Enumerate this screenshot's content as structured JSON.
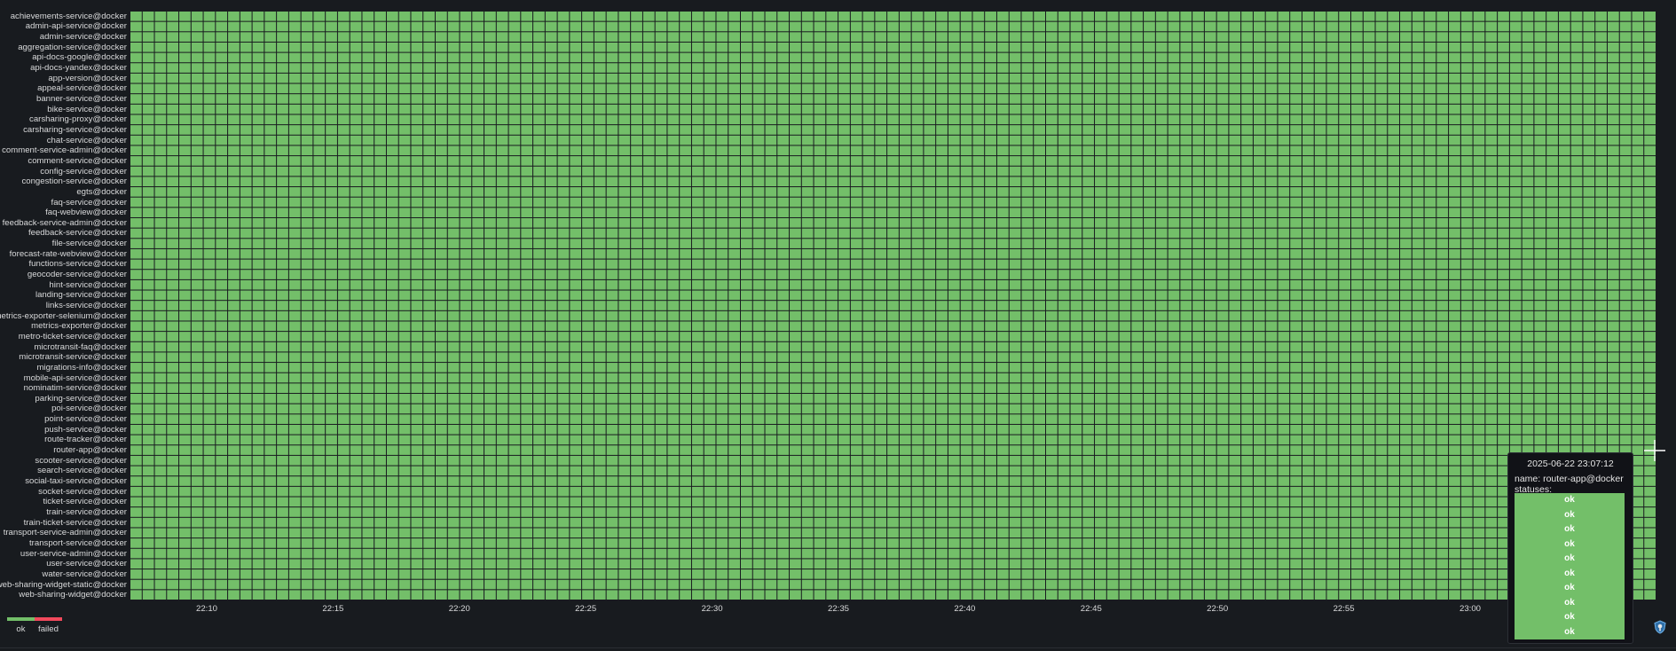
{
  "colors": {
    "ok": "#73bf69",
    "failed": "#f2495c",
    "background": "#181b1f",
    "cell_border": "#181b1f",
    "text": "#d8d9da"
  },
  "services": [
    "achievements-service@docker",
    "admin-api-service@docker",
    "admin-service@docker",
    "aggregation-service@docker",
    "api-docs-google@docker",
    "api-docs-yandex@docker",
    "app-version@docker",
    "appeal-service@docker",
    "banner-service@docker",
    "bike-service@docker",
    "carsharing-proxy@docker",
    "carsharing-service@docker",
    "chat-service@docker",
    "comment-service-admin@docker",
    "comment-service@docker",
    "config-service@docker",
    "congestion-service@docker",
    "egts@docker",
    "faq-service@docker",
    "faq-webview@docker",
    "feedback-service-admin@docker",
    "feedback-service@docker",
    "file-service@docker",
    "forecast-rate-webview@docker",
    "functions-service@docker",
    "geocoder-service@docker",
    "hint-service@docker",
    "landing-service@docker",
    "links-service@docker",
    "metrics-exporter-selenium@docker",
    "metrics-exporter@docker",
    "metro-ticket-service@docker",
    "microtransit-faq@docker",
    "microtransit-service@docker",
    "migrations-info@docker",
    "mobile-api-service@docker",
    "nominatim-service@docker",
    "parking-service@docker",
    "poi-service@docker",
    "point-service@docker",
    "push-service@docker",
    "route-tracker@docker",
    "router-app@docker",
    "scooter-service@docker",
    "search-service@docker",
    "social-taxi-service@docker",
    "socket-service@docker",
    "ticket-service@docker",
    "train-service@docker",
    "train-ticket-service@docker",
    "transport-service-admin@docker",
    "transport-service@docker",
    "user-service-admin@docker",
    "user-service@docker",
    "water-service@docker",
    "web-sharing-widget-static@docker",
    "web-sharing-widget@docker"
  ],
  "columns": 125,
  "status_all": "ok",
  "x_axis": {
    "ticks": [
      "22:10",
      "22:15",
      "22:20",
      "22:25",
      "22:30",
      "22:35",
      "22:40",
      "22:45",
      "22:50",
      "22:55",
      "23:00"
    ]
  },
  "legend": [
    {
      "label": "ok",
      "color": "#73bf69"
    },
    {
      "label": "failed",
      "color": "#f2495c"
    }
  ],
  "tooltip": {
    "time": "2025-06-22 23:07:12",
    "name_text": "name: router-app@docker",
    "statuses_label": "statuses:",
    "statuses": [
      "ok",
      "ok",
      "ok",
      "ok",
      "ok",
      "ok",
      "ok",
      "ok",
      "ok",
      "ok"
    ]
  },
  "icons": {
    "crosshair": "crosshair-icon",
    "corner": "grafana-shield-icon"
  }
}
